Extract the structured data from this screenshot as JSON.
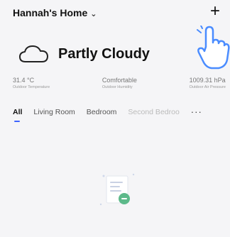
{
  "header": {
    "home_name": "Hannah's Home",
    "add_label": "+"
  },
  "weather": {
    "condition": "Partly Cloudy",
    "stats": [
      {
        "value": "31.4 °C",
        "label": "Outdoor Temperature"
      },
      {
        "value": "Comfortable",
        "label": "Outdoor Humidity"
      },
      {
        "value": "1009.31 hPa",
        "label": "Outdoor Air Pressure"
      }
    ]
  },
  "tabs": [
    {
      "label": "All",
      "active": true
    },
    {
      "label": "Living Room"
    },
    {
      "label": "Bedroom"
    },
    {
      "label": "Second Bedroo"
    }
  ],
  "more_label": "···",
  "colors": {
    "background": "#f5f5f7",
    "accent": "#3d63ff",
    "illustration_green": "#5cb98a",
    "pointer": "#4a8cff"
  }
}
